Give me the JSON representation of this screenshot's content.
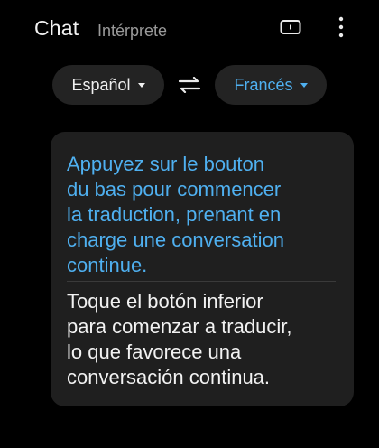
{
  "header": {
    "tabs": {
      "chat": "Chat",
      "interpreter": "Intérprete"
    },
    "icons": {
      "subtitle": "subtitles-icon",
      "more": "more-vertical-icon"
    }
  },
  "languages": {
    "source": "Español",
    "target": "Francés",
    "swap_icon": "swap-arrows-icon"
  },
  "card": {
    "translated_text": "Appuyez sur le bouton\ndu bas pour commencer\nla traduction, prenant en\ncharge une conversation\ncontinue.",
    "source_text": "Toque el botón inferior\npara comenzar a traducir,\nlo que favorece una\nconversación continua."
  },
  "colors": {
    "background": "#000000",
    "accent": "#4fb0f0",
    "card": "#1f1f1f",
    "pill": "#232323",
    "muted_text": "#9a9a9a"
  }
}
